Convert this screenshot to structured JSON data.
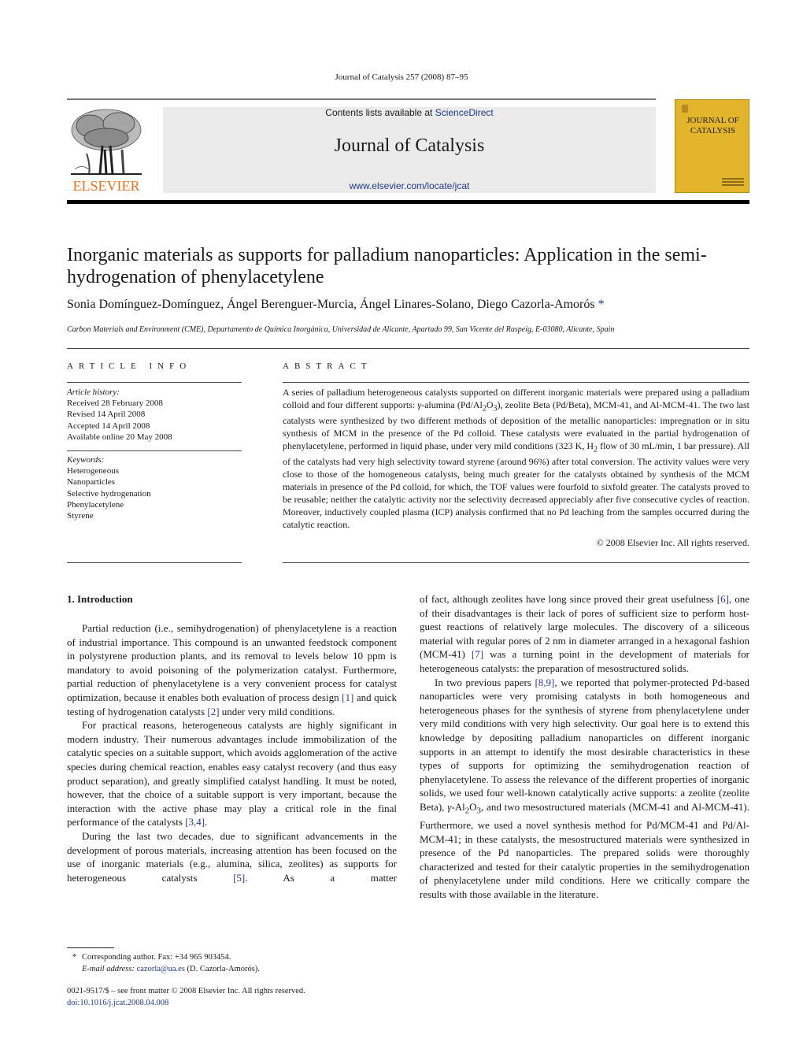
{
  "running_head": "Journal of Catalysis 257 (2008) 87–95",
  "masthead": {
    "publisher": "ELSEVIER",
    "contents_prefix": "Contents lists available at ",
    "contents_link": "ScienceDirect",
    "journal_title": "Journal of Catalysis",
    "journal_url": "www.elsevier.com/locate/jcat",
    "cover_title_line1": "JOURNAL OF",
    "cover_title_line2": "CATALYSIS",
    "colors": {
      "publisher_orange": "#e8731a",
      "cover_yellow": "#e3b52a",
      "link_blue": "#1f3a8a",
      "masthead_gray": "#ebebeb"
    }
  },
  "article": {
    "title": "Inorganic materials as supports for palladium nanoparticles: Application in the semi-hydrogenation of phenylacetylene",
    "authors": "Sonia Domínguez-Domínguez, Ángel Berenguer-Murcia, Ángel Linares-Solano, Diego Cazorla-Amorós",
    "corresponding_marker": "*",
    "affiliation": "Carbon Materials and Environment (CME), Departamento de Química Inorgánica, Universidad de Alicante, Apartado 99, San Vicente del Raspeig, E-03080, Alicante, Spain"
  },
  "article_info": {
    "heading": "ARTICLE INFO",
    "history_label": "Article history:",
    "history": [
      "Received 28 February 2008",
      "Revised 14 April 2008",
      "Accepted 14 April 2008",
      "Available online 20 May 2008"
    ],
    "keywords_label": "Keywords:",
    "keywords": [
      "Heterogeneous",
      "Nanoparticles",
      "Selective hydrogenation",
      "Phenylacetylene",
      "Styrene"
    ]
  },
  "abstract": {
    "heading": "ABSTRACT",
    "text_a": "A series of palladium heterogeneous catalysts supported on different inorganic materials were prepared using a palladium colloid and four different supports: ",
    "gamma": "γ",
    "text_b": "-alumina (Pd/Al",
    "sub2": "2",
    "text_c": "O",
    "sub3": "3",
    "text_d": "), zeolite Beta (Pd/Beta), MCM-41, and Al-MCM-41. The two last catalysts were synthesized by two different methods of deposition of the metallic nanoparticles: impregnation or in situ synthesis of MCM in the presence of the Pd colloid. These catalysts were evaluated in the partial hydrogenation of phenylacetylene, performed in liquid phase, under very mild conditions (323 K, H",
    "sub_h": "2",
    "text_e": " flow of 30 mL/min, 1 bar pressure). All of the catalysts had very high selectivity toward styrene (around 96%) after total conversion. The activity values were very close to those of the homogeneous catalysts, being much greater for the catalysts obtained by synthesis of the MCM materials in presence of the Pd colloid, for which, the TOF values were fourfold to sixfold greater. The catalysts proved to be reusable; neither the catalytic activity nor the selectivity decreased appreciably after five consecutive cycles of reaction. Moreover, inductively coupled plasma (ICP) analysis confirmed that no Pd leaching from the samples occurred during the catalytic reaction.",
    "copyright": "© 2008 Elsevier Inc. All rights reserved."
  },
  "introduction": {
    "heading": "1. Introduction",
    "p1_a": "Partial reduction (i.e., semihydrogenation) of phenylacetylene is a reaction of industrial importance. This compound is an unwanted feedstock component in polystyrene production plants, and its removal to levels below 10 ppm is mandatory to avoid poisoning of the polymerization catalyst. Furthermore, partial reduction of phenylacetylene is a very convenient process for catalyst optimization, because it enables both evaluation of process design ",
    "ref1": "[1]",
    "p1_b": " and quick testing of hydrogenation catalysts ",
    "ref2": "[2]",
    "p1_c": " under very mild conditions.",
    "p2_a": "For practical reasons, heterogeneous catalysts are highly significant in modern industry. Their numerous advantages include immobilization of the catalytic species on a suitable support, which avoids agglomeration of the active species during chemical reaction, enables easy catalyst recovery (and thus easy product separation), and greatly simplified catalyst handling. It must be noted, however, that the choice of a suitable support is very important, because the interaction with the active phase may play a critical role in the final performance of the catalysts ",
    "ref34": "[3,4]",
    "p2_b": ".",
    "p3_a": "During the last two decades, due to significant advancements in the development of porous materials, increasing attention has been focused on the use of inorganic materials (e.g., alumina, silica, zeolites) as supports for heterogeneous catalysts ",
    "ref5": "[5]",
    "p3_b": ". As a matter",
    "p3_c": "of fact, although zeolites have long since proved their great usefulness ",
    "ref6": "[6]",
    "p3_d": ", one of their disadvantages is their lack of pores of sufficient size to perform host-guest reactions of relatively large molecules. The discovery of a siliceous material with regular pores of 2 nm in diameter arranged in a hexagonal fashion (MCM-41) ",
    "ref7": "[7]",
    "p3_e": " was a turning point in the development of materials for heterogeneous catalysts: the preparation of mesostructured solids.",
    "p4_a": "In two previous papers ",
    "ref89": "[8,9]",
    "p4_b": ", we reported that polymer-protected Pd-based nanoparticles were very promising catalysts in both homogeneous and heterogeneous phases for the synthesis of styrene from phenylacetylene under very mild conditions with very high selectivity. Our goal here is to extend this knowledge by depositing palladium nanoparticles on different inorganic supports in an attempt to identify the most desirable characteristics in these types of supports for optimizing the semihydrogenation reaction of phenylacetylene. To assess the relevance of the different properties of inorganic solids, we used four well-known catalytically active supports: a zeolite (zeolite Beta), ",
    "gamma": "γ",
    "p4_c": "-Al",
    "sub2": "2",
    "p4_d": "O",
    "sub3": "3",
    "p4_e": ", and two mesostructured materials (MCM-41 and Al-MCM-41). Furthermore, we used a novel synthesis method for Pd/MCM-41 and Pd/Al-MCM-41; in these catalysts, the mesostructured materials were synthesized in presence of the Pd nanoparticles. The prepared solids were thoroughly characterized and tested for their catalytic properties in the semihydrogenation of phenylacetylene under mild conditions. Here we critically compare the results with those available in the literature."
  },
  "footnote": {
    "marker": "*",
    "corresponding": "Corresponding author. Fax: +34 965 903454.",
    "email_label": "E-mail address:",
    "email": "cazorla@ua.es",
    "email_suffix": " (D. Cazorla-Amorós)."
  },
  "front_matter": {
    "issn_line": "0021-9517/$ – see front matter  © 2008 Elsevier Inc. All rights reserved.",
    "doi": "doi:10.1016/j.jcat.2008.04.008"
  }
}
